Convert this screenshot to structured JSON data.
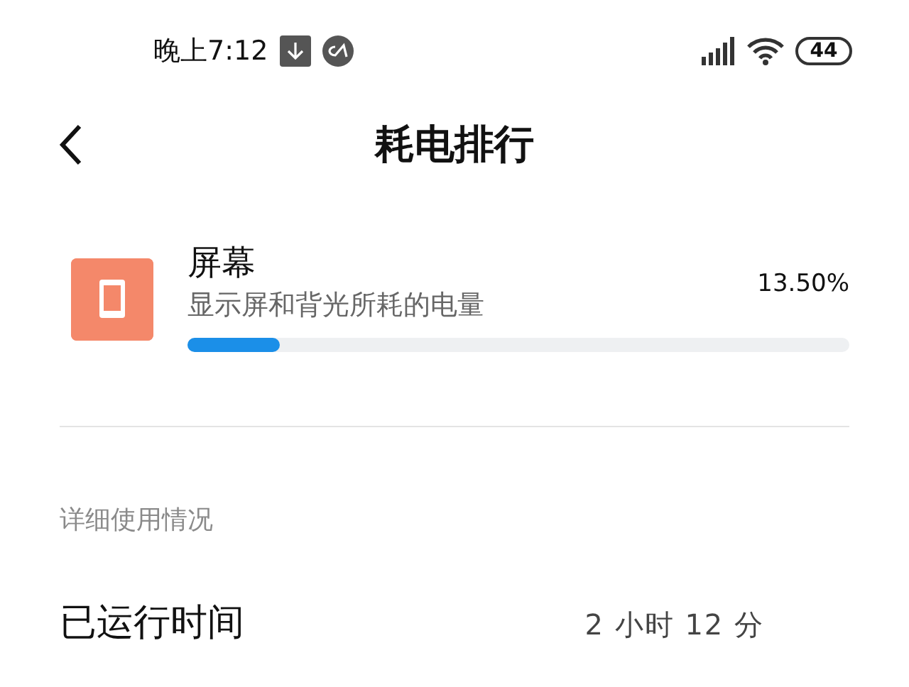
{
  "status_bar": {
    "time": "晚上7:12",
    "battery": "44"
  },
  "header": {
    "title": "耗电排行"
  },
  "item": {
    "name": "屏幕",
    "description": "显示屏和背光所耗的电量",
    "percent": "13.50%",
    "level": 0.14
  },
  "section": {
    "title": "详细使用情况"
  },
  "details": [
    {
      "label": "已运行时间",
      "value": "2 小时 12 分"
    }
  ]
}
